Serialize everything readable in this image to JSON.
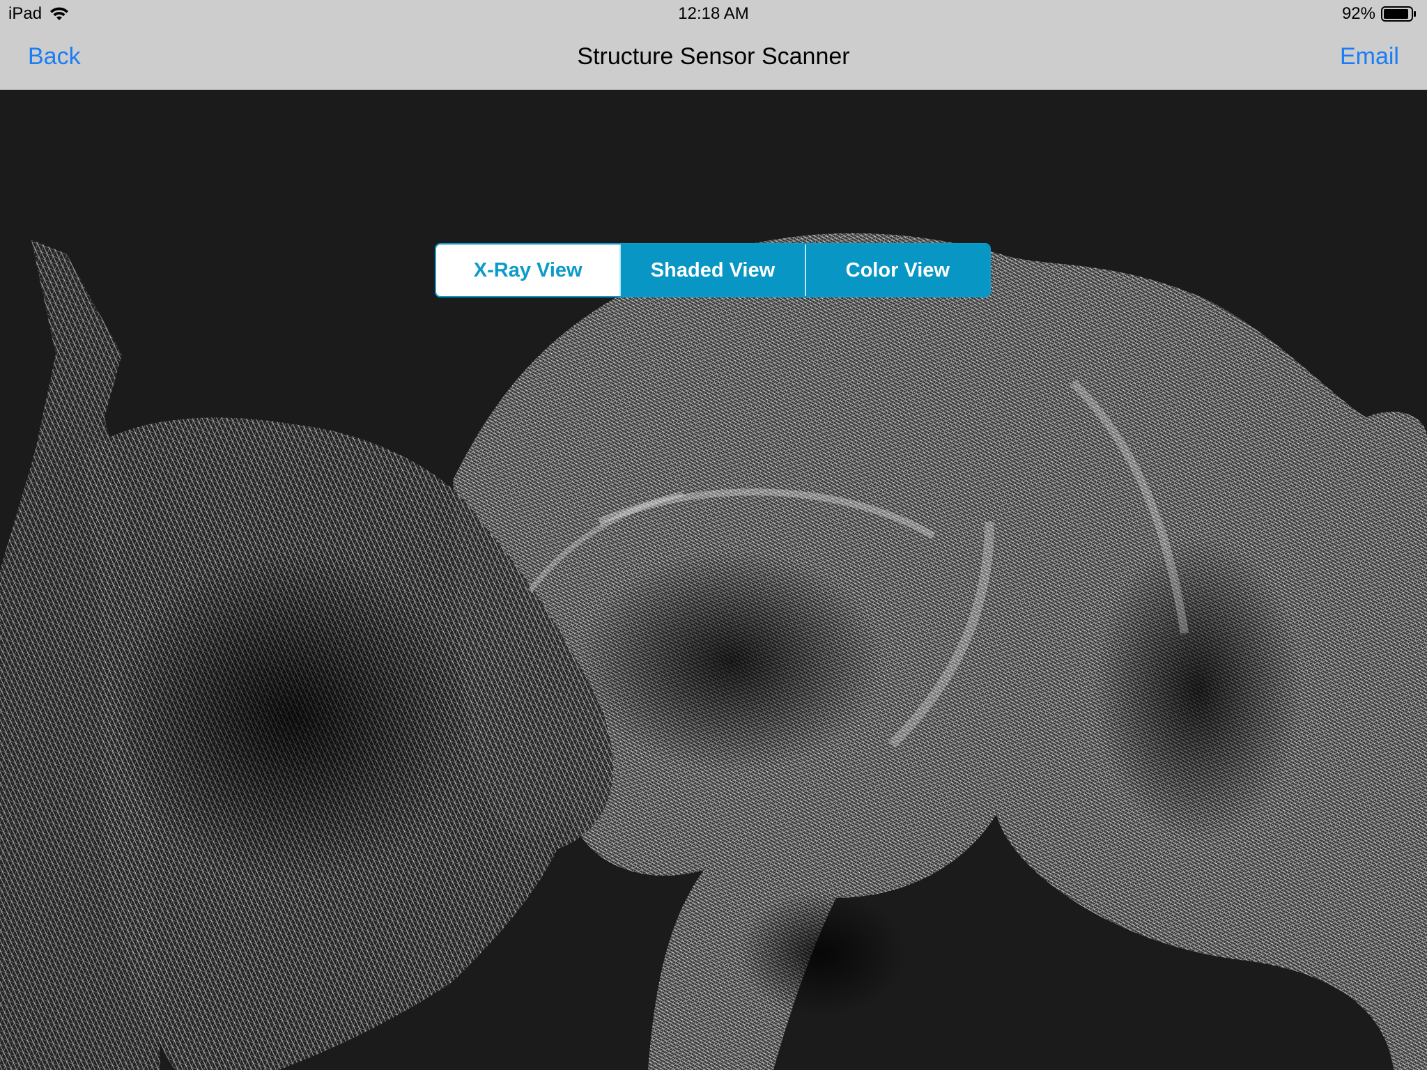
{
  "status_bar": {
    "device": "iPad",
    "time": "12:18 AM",
    "battery": "92%",
    "battery_level": 0.92,
    "icons": [
      "wifi-icon",
      "battery-icon"
    ]
  },
  "nav": {
    "back_label": "Back",
    "title": "Structure Sensor Scanner",
    "email_label": "Email"
  },
  "view_modes": {
    "selected": "X-Ray View",
    "options": [
      "X-Ray View",
      "Shaded View",
      "Color View"
    ]
  },
  "colors": {
    "accent": "#0b9bc9",
    "link": "#1a7df5",
    "bar_background": "#cdcdcd",
    "viewport_background": "#1b1b1b"
  }
}
